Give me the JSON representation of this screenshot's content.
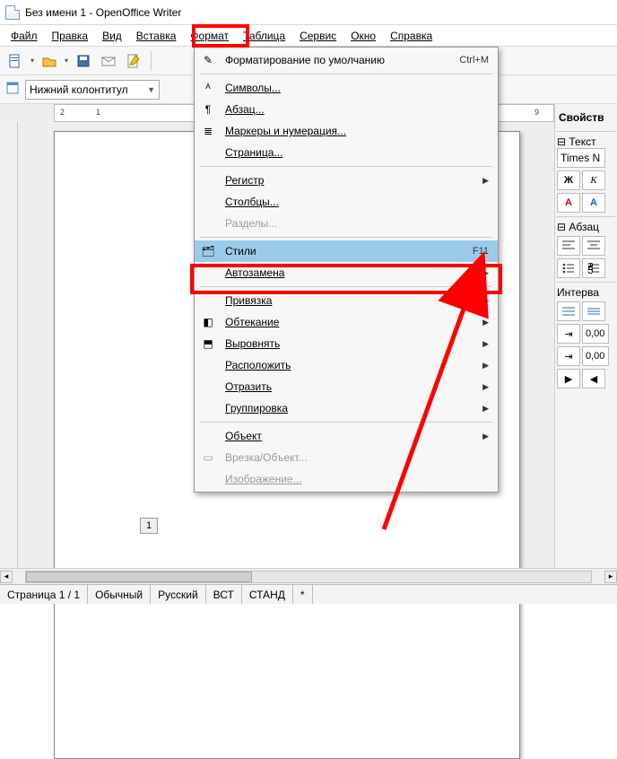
{
  "window": {
    "title": "Без имени 1 - OpenOffice Writer"
  },
  "menubar": {
    "file": "Файл",
    "edit": "Правка",
    "view": "Вид",
    "insert": "Вставка",
    "format": "Формат",
    "table": "Таблица",
    "tools": "Сервис",
    "window": "Окно",
    "help": "Справка"
  },
  "toolbar2": {
    "style_dd": "Нижний колонтитул"
  },
  "format_menu": {
    "default_formatting": {
      "label": "Форматирование по умолчанию",
      "shortcut": "Ctrl+M"
    },
    "characters": "Символы...",
    "paragraph": "Абзац...",
    "bullets": "Маркеры и нумерация...",
    "page": "Страница...",
    "case": "Регистр",
    "columns": "Столбцы...",
    "sections": "Разделы...",
    "styles": {
      "label": "Стили",
      "shortcut": "F11"
    },
    "autocorrect": "Автозамена",
    "anchor": "Привязка",
    "wrap": "Обтекание",
    "align": "Выровнять",
    "arrange": "Расположить",
    "flip": "Отразить",
    "group": "Группировка",
    "object": "Объект",
    "frame": "Врезка/Объект...",
    "image": "Изображение..."
  },
  "side": {
    "properties": "Свойств",
    "text_hdr": "Текст",
    "font": "Times N",
    "bold": "Ж",
    "italic": "К",
    "fontcolor": "A",
    "highlight": "A",
    "para_hdr": "Абзац",
    "spacing_hdr": "Интерва",
    "indent1": "0,00",
    "indent2": "0,00"
  },
  "ruler": {
    "neg2": "2",
    "neg1": "1",
    "nine": "9"
  },
  "page_field": "1",
  "status": {
    "page": "Страница  1 / 1",
    "style": "Обычный",
    "lang": "Русский",
    "ins": "ВСТ",
    "std": "СТАНД",
    "mod": "*"
  }
}
